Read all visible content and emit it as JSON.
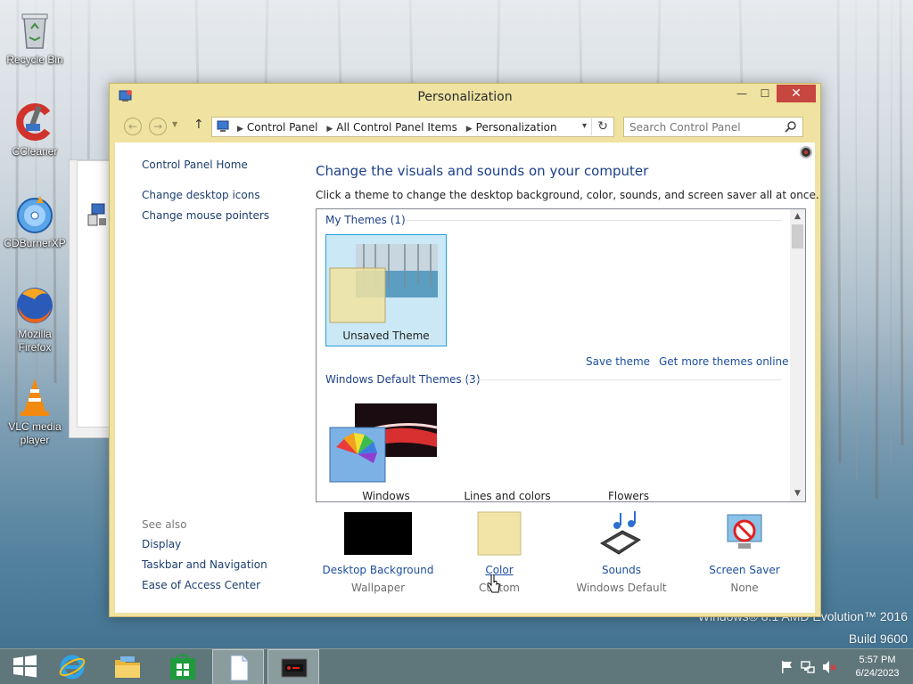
{
  "desktop": {
    "icons": [
      {
        "label": "Recycle Bin",
        "icon": "recycle-bin-icon"
      },
      {
        "label": "CCleaner",
        "icon": "ccleaner-icon"
      },
      {
        "label": "CDBurnerXP",
        "icon": "cdburnerxp-icon"
      },
      {
        "label": "Mozilla Firefox",
        "icon": "firefox-icon"
      },
      {
        "label": "VLC media player",
        "icon": "vlc-icon"
      }
    ],
    "watermark_line1": "Windows® 8.1 AMD Evolution™ 2016",
    "watermark_line2": "Build 9600"
  },
  "window": {
    "title": "Personalization",
    "controls": {
      "minimize": "—",
      "maximize": "☐",
      "close": "✕"
    },
    "breadcrumbs": [
      "Control Panel",
      "All Control Panel Items",
      "Personalization"
    ],
    "search": {
      "placeholder": "Search Control Panel",
      "value": ""
    },
    "left_links": [
      "Control Panel Home",
      "Change desktop icons",
      "Change mouse pointers"
    ],
    "heading": "Change the visuals and sounds on your computer",
    "subheading": "Click a theme to change the desktop background, color, sounds, and screen saver all at once.",
    "my_themes": {
      "label": "My Themes (1)",
      "themes": [
        {
          "name": "Unsaved Theme",
          "selected": true
        }
      ],
      "save_link": "Save theme",
      "more_link": "Get more themes online"
    },
    "default_themes": {
      "label": "Windows Default Themes (3)",
      "themes": [
        {
          "name": "Windows"
        },
        {
          "name": "Lines and colors"
        },
        {
          "name": "Flowers"
        }
      ]
    },
    "see_also": {
      "title": "See also",
      "links": [
        "Display",
        "Taskbar and Navigation",
        "Ease of Access Center"
      ]
    },
    "bottom": [
      {
        "link": "Desktop Background",
        "sub": "Wallpaper"
      },
      {
        "link": "Color",
        "sub": "Custom"
      },
      {
        "link": "Sounds",
        "sub": "Windows Default"
      },
      {
        "link": "Screen Saver",
        "sub": "None"
      }
    ]
  },
  "taskbar": {
    "pinned": [
      "start-icon",
      "internet-explorer-icon",
      "file-explorer-icon",
      "store-icon",
      "document-icon",
      "control-panel-icon"
    ],
    "tray": [
      "flag-icon",
      "network-icon",
      "volume-muted-icon"
    ],
    "time": "5:57 PM",
    "date": "6/24/2023"
  },
  "colors": {
    "window_frame": "#f0e2a0",
    "close_button": "#c7463f",
    "link": "#1c4fa0",
    "selection": "#cbe8f6"
  }
}
